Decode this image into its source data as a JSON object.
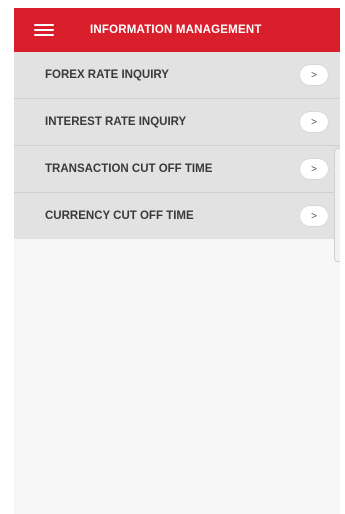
{
  "header": {
    "title": "INFORMATION MANAGEMENT",
    "menu_icon": "hamburger-menu-icon",
    "background_color": "#d91f2b"
  },
  "menu": {
    "items": [
      {
        "label": "FOREX RATE INQUIRY",
        "arrow": ">"
      },
      {
        "label": "INTEREST RATE INQUIRY",
        "arrow": ">"
      },
      {
        "label": "TRANSACTION CUT OFF TIME",
        "arrow": ">"
      },
      {
        "label": "CURRENCY CUT OFF TIME",
        "arrow": ">"
      }
    ]
  }
}
